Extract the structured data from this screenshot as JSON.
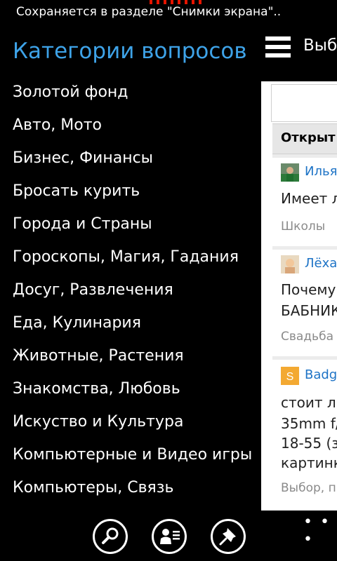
{
  "toast": {
    "text": "Сохраняется в разделе \"Снимки экрана\".."
  },
  "sidebar": {
    "title": "Категории вопросов",
    "items": [
      "Золотой фонд",
      "Авто, Мото",
      "Бизнес, Финансы",
      "Бросать курить",
      "Города и Страны",
      "Гороскопы, Магия, Гадания",
      "Досуг, Развлечения",
      "Еда, Кулинария",
      "Животные, Растения",
      "Знакомства, Любовь",
      "Искуство и Культура",
      "Компьютерные и Видео игры",
      "Компьютеры, Связь"
    ]
  },
  "header": {
    "menu_icon": "hamburger-icon",
    "text": "Выб"
  },
  "main": {
    "search_placeholder": "",
    "tab_label": "Открыт",
    "questions": [
      {
        "author": "Илья",
        "text_lines": [
          "Имеет л"
        ],
        "category": "Школы"
      },
      {
        "author": "Лёха",
        "text_lines": [
          "Почему",
          "БАБНИК"
        ],
        "category": "Свадьба"
      },
      {
        "author": "Badg",
        "text_lines": [
          "стоит ли",
          "35mm f/",
          "18-55 (з",
          "картинк"
        ],
        "category": "Выбор, п"
      }
    ]
  },
  "appbar": {
    "buttons": [
      "search-icon",
      "user-list-icon",
      "pin-icon"
    ],
    "more": "• • •"
  },
  "colors": {
    "accent": "#3ea3e8",
    "link": "#1d73c6",
    "background": "#000000",
    "panel": "#ffffff",
    "record": "#e51400"
  }
}
